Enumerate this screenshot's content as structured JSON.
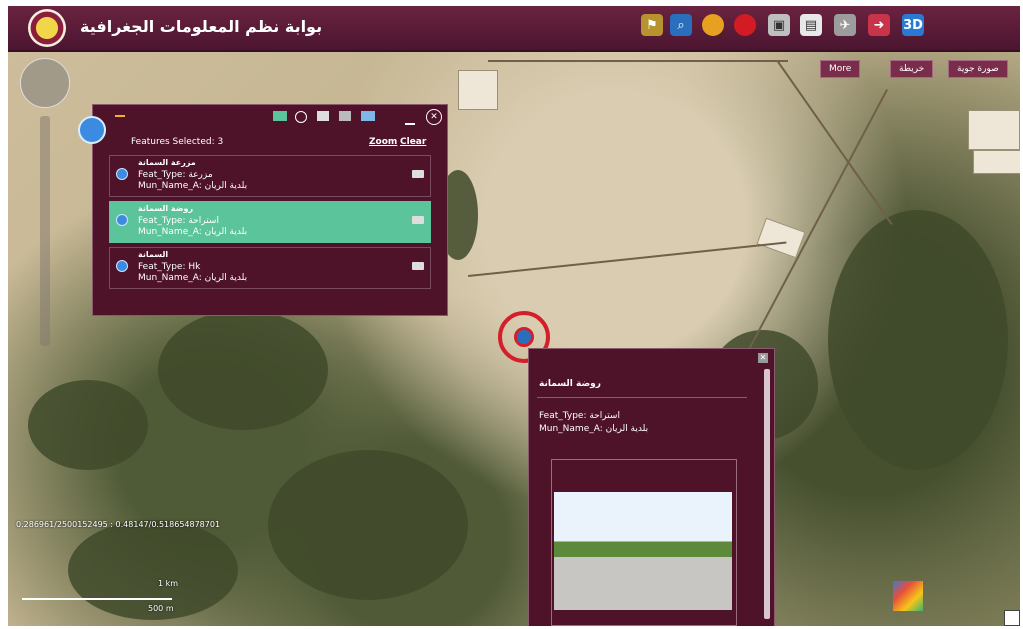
{
  "header": {
    "title": "بوابة نظم المعلومات الجغرافية",
    "tools": [
      "flag-icon",
      "search-icon",
      "orange-circle-icon",
      "red-circle-icon",
      "camera-icon",
      "document-icon",
      "satellite-icon",
      "arrow-icon",
      "3d-icon"
    ]
  },
  "layers": {
    "more": "More",
    "map": "خريطة",
    "image": "صورة جوية"
  },
  "features": {
    "count_label": "Features Selected: 3",
    "zoom": "Zoom",
    "clear": "Clear",
    "items": [
      {
        "name": "مزرعة السمانة",
        "type": "Feat_Type: مزرعة",
        "mun": "Mun_Name_A: بلدية الريان",
        "selected": false
      },
      {
        "name": "روضة السمانة",
        "type": "Feat_Type: استراحة",
        "mun": "Mun_Name_A: بلدية الريان",
        "selected": true
      },
      {
        "name": "السمانة",
        "type": "Feat_Type: Hk",
        "mun": "Mun_Name_A: بلدية الريان",
        "selected": false
      }
    ]
  },
  "popup": {
    "title": "روضة السمانة",
    "type": "Feat_Type: استراحة",
    "mun": "Mun_Name_A: بلدية الريان"
  },
  "coords": "0.286961/2500152495 : 0.48147/0.518654878701",
  "scale": {
    "top": "1 km",
    "bottom": "500 m"
  },
  "colors": {
    "maroon": "#4e1329",
    "selected": "#5cc49a",
    "accent": "#d41f2a"
  }
}
